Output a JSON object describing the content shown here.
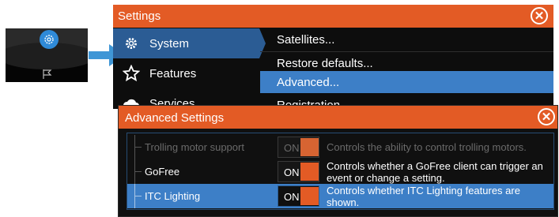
{
  "settings": {
    "title": "Settings",
    "nav": [
      {
        "label": "System",
        "icon": "gear-icon"
      },
      {
        "label": "Features",
        "icon": "star-icon"
      },
      {
        "label": "Services",
        "icon": "cloud-icon"
      }
    ],
    "menu": [
      "Satellites...",
      "Restore defaults...",
      "Advanced...",
      "Registration..."
    ]
  },
  "advanced": {
    "title": "Advanced Settings",
    "rows": [
      {
        "name": "Trolling motor support",
        "value": "ON",
        "description": "Controls the ability to control trolling motors."
      },
      {
        "name": "GoFree",
        "value": "ON",
        "description": "Controls whether a GoFree client can trigger an event or change a setting."
      },
      {
        "name": "ITC Lighting",
        "value": "ON",
        "description": "Controls whether ITC Lighting features are shown."
      }
    ]
  },
  "colors": {
    "accent": "#e35b25",
    "selection": "#3d7fc7",
    "nav_selection": "#2b5c94",
    "arrow": "#3f96d6"
  }
}
